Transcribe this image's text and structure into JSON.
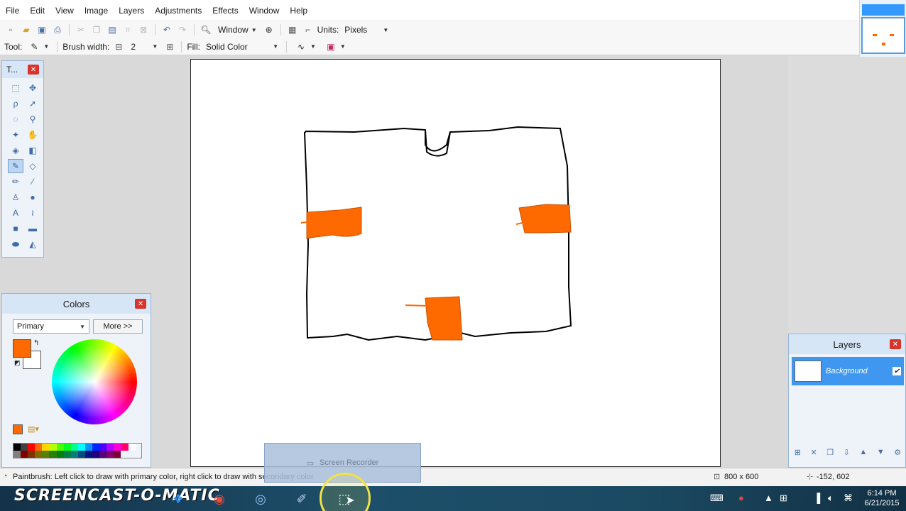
{
  "menu": [
    "File",
    "Edit",
    "View",
    "Image",
    "Layers",
    "Adjustments",
    "Effects",
    "Window",
    "Help"
  ],
  "toolbar": {
    "zoom_label": "Window",
    "units_label": "Units:",
    "units_value": "Pixels"
  },
  "tool_options": {
    "tool_label": "Tool:",
    "brush_width_label": "Brush width:",
    "brush_width_value": "2",
    "fill_label": "Fill:",
    "fill_value": "Solid Color"
  },
  "tools_panel": {
    "title": "T..."
  },
  "colors_panel": {
    "title": "Colors",
    "mode": "Primary",
    "more_button": "More >>",
    "primary_color": "#ff6a00",
    "secondary_color": "#ffffff",
    "palette": [
      "#000000",
      "#404040",
      "#ff0000",
      "#ff6a00",
      "#ffd800",
      "#b6ff00",
      "#4cff00",
      "#00ff21",
      "#00ff90",
      "#00ffff",
      "#0094ff",
      "#0026ff",
      "#4800ff",
      "#b200ff",
      "#ff00dc",
      "#ff006e",
      "#ffffff",
      "#808080",
      "#7f0000",
      "#7f3300",
      "#7f6a00",
      "#5b7f00",
      "#267f00",
      "#007f0e",
      "#007f46",
      "#007f7f",
      "#004a7f",
      "#00137f",
      "#21007f",
      "#57007f",
      "#7f006e",
      "#7f0037"
    ]
  },
  "layers_panel": {
    "title": "Layers",
    "layer_name": "Background",
    "visible": true
  },
  "status": {
    "hint": "Paintbrush: Left click to draw with primary color, right click to draw with secondary color",
    "image_size": "800 x 600",
    "cursor_pos": "-152, 602"
  },
  "recorder": {
    "label": "Screen Recorder"
  },
  "watermark": "SCREENCAST-O-MATIC",
  "clock": {
    "time": "6:14 PM",
    "date": "6/21/2015"
  }
}
